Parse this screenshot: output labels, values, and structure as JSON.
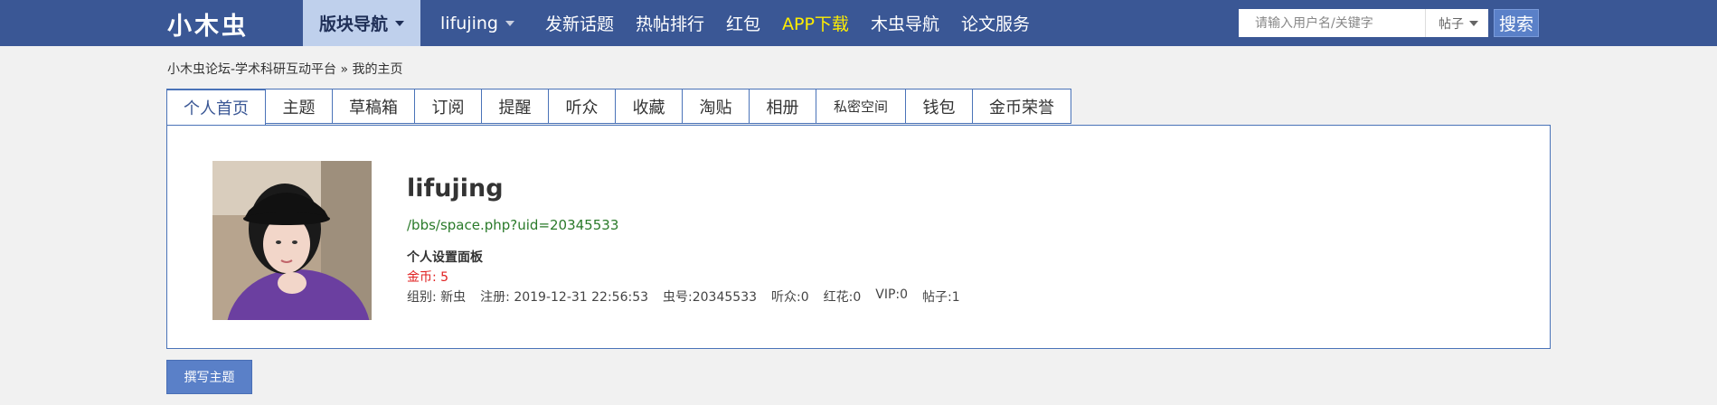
{
  "header": {
    "logo_text": "小木虫",
    "nav": [
      {
        "label": "版块导航",
        "caret": true
      },
      {
        "label": "lifujing",
        "caret": true
      },
      {
        "label": "发新话题"
      },
      {
        "label": "热帖排行"
      },
      {
        "label": "红包"
      },
      {
        "label": "APP下载"
      },
      {
        "label": "木虫导航"
      },
      {
        "label": "论文服务"
      }
    ],
    "search": {
      "placeholder": "请输入用户名/关键字",
      "type_selected": "帖子",
      "button_label": "搜索"
    }
  },
  "breadcrumb": {
    "root": "小木虫论坛-学术科研互动平台",
    "separator": "»",
    "current": "我的主页"
  },
  "tabs": [
    "个人首页",
    "主题",
    "草稿箱",
    "订阅",
    "提醒",
    "听众",
    "收藏",
    "淘贴",
    "相册",
    "私密空间",
    "钱包",
    "金币荣誉"
  ],
  "profile": {
    "username": "lifujing",
    "space_url": "/bbs/space.php?uid=20345533",
    "settings_label": "个人设置面板",
    "coins": "金币: 5",
    "stats": {
      "group": "组别: 新虫",
      "registered": "注册: 2019-12-31 22:56:53",
      "id": "虫号:20345533",
      "listeners": "听众:0",
      "flowers": "红花:0",
      "vip": "VIP:0",
      "posts": "帖子:1"
    }
  },
  "compose_button": "撰写主题",
  "colors": {
    "topbar": "#3a5795",
    "active_nav": "#bfd0ec",
    "highlight": "#ffee00",
    "tab_border": "#4a73b8",
    "link_green": "#2a7a2a",
    "coin_red": "#e02020",
    "button_blue": "#5a80c8"
  }
}
